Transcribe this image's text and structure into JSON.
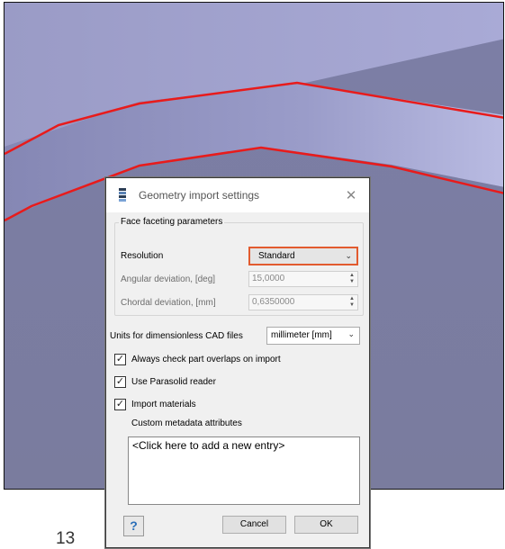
{
  "page": {
    "number": "13"
  },
  "dialog": {
    "title": "Geometry import settings",
    "close_glyph": "✕",
    "face_group": {
      "legend": "Face faceting parameters",
      "resolution": {
        "label": "Resolution",
        "value": "Standard"
      },
      "angular": {
        "label": "Angular deviation, [deg]",
        "value": "15,0000"
      },
      "chordal": {
        "label": "Chordal deviation, [mm]",
        "value": "0,6350000"
      }
    },
    "units": {
      "label": "Units for dimensionless CAD files",
      "value": "millimeter [mm]"
    },
    "checkboxes": [
      {
        "label": "Always check part overlaps on import",
        "checked": true
      },
      {
        "label": "Use Parasolid reader",
        "checked": true
      },
      {
        "label": "Import materials",
        "checked": true
      }
    ],
    "metadata": {
      "label": "Custom metadata attributes",
      "placeholder_entry": "<Click here to add a new entry>"
    },
    "buttons": {
      "help": "?",
      "cancel": "Cancel",
      "ok": "OK"
    }
  },
  "icons": {
    "app": "app-logo-icon",
    "close": "close-icon",
    "chevron": "chevron-down-icon",
    "spin": "spin-arrows-icon",
    "check": "check-icon",
    "help": "help-icon"
  },
  "colors": {
    "viewport_bg": "#8a8db2",
    "edge_highlight": "#e81b1b",
    "select_highlight": "#e25b2f"
  }
}
